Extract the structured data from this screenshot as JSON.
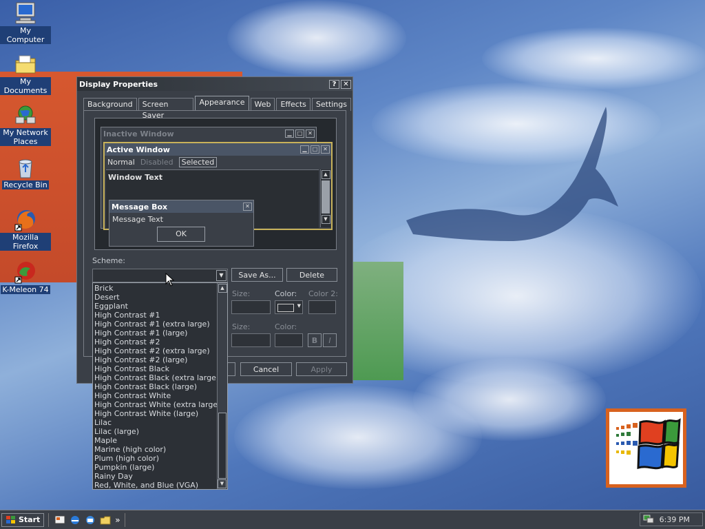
{
  "desktop": {
    "icons": [
      {
        "label": "My Computer"
      },
      {
        "label": "My Documents"
      },
      {
        "label": "My Network Places"
      },
      {
        "label": "Recycle Bin"
      },
      {
        "label": "Mozilla Firefox"
      },
      {
        "label": "K-Meleon 74"
      }
    ]
  },
  "window": {
    "title": "Display Properties",
    "help_glyph": "?",
    "close_glyph": "✕",
    "tabs": [
      "Background",
      "Screen Saver",
      "Appearance",
      "Web",
      "Effects",
      "Settings"
    ],
    "active_tab": "Appearance",
    "preview": {
      "inactive_title": "Inactive Window",
      "active_title": "Active Window",
      "menu": [
        "Normal",
        "Disabled",
        "Selected"
      ],
      "window_text": "Window Text",
      "msgbox_title": "Message Box",
      "msgbox_text": "Message Text",
      "ok_label": "OK"
    },
    "scheme_label": "Scheme:",
    "save_as_label": "Save As...",
    "delete_label": "Delete",
    "item_size_label": "Size:",
    "item_color_label": "Color:",
    "item_color2_label": "Color 2:",
    "font_size_label": "Size:",
    "font_color_label": "Color:",
    "bold_label": "B",
    "italic_label": "I",
    "cancel_label": "Cancel",
    "apply_label": "Apply"
  },
  "scheme_list": [
    "Brick",
    "Desert",
    "Eggplant",
    "High Contrast #1",
    "High Contrast #1 (extra large)",
    "High Contrast #1 (large)",
    "High Contrast #2",
    "High Contrast #2 (extra large)",
    "High Contrast #2 (large)",
    "High Contrast Black",
    "High Contrast Black (extra large)",
    "High Contrast Black (large)",
    "High Contrast White",
    "High Contrast White (extra large)",
    "High Contrast White (large)",
    "Lilac",
    "Lilac (large)",
    "Maple",
    "Marine (high color)",
    "Plum (high color)",
    "Pumpkin (large)",
    "Rainy Day",
    "Red, White, and Blue (VGA)"
  ],
  "taskbar": {
    "start_label": "Start",
    "chevron": "»",
    "clock": "6:39 PM"
  },
  "colors": {
    "window_bg": "#3a3f47",
    "preview_bg": "#25292e",
    "active_frame": "#c8b25a",
    "active_title_bg": "#4a6fa5"
  }
}
